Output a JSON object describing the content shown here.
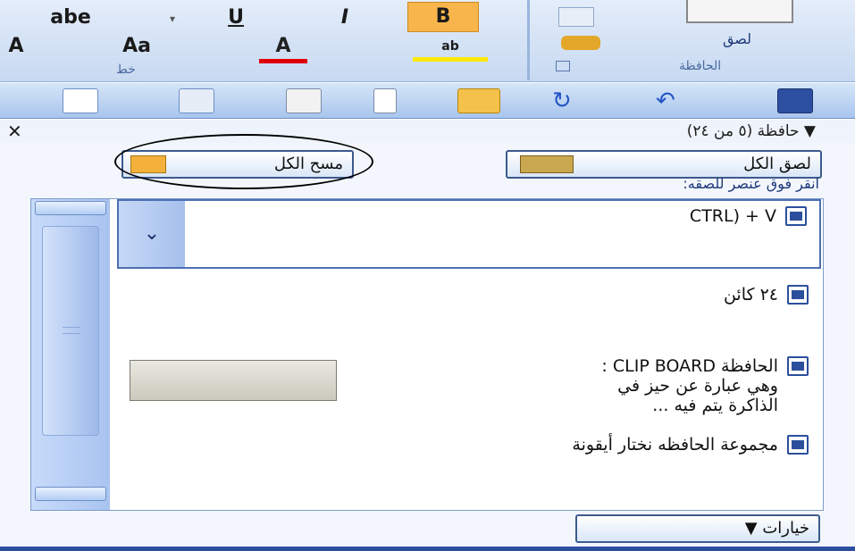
{
  "ribbon": {
    "font_group_label": "خط",
    "clipboard_group_label": "الحافظة",
    "paste_label": "لصق",
    "strike_label": "abe",
    "underline_label": "U",
    "italic_label": "I",
    "bold_label": "B",
    "grow_font_label": "A",
    "change_case_label": "Aa",
    "font_color_label": "A",
    "highlight_label": "ab"
  },
  "pane": {
    "title": "▼ حافظة (٥ من ٢٤)",
    "close": "✕",
    "paste_all_label": "لصق الكل",
    "clear_all_label": "مسح الكل",
    "hint": "انقر فوق عنصر للصقه:",
    "options_label": "خيارات ▼"
  },
  "items": [
    {
      "text": "CTRL) + V"
    },
    {
      "text": "٢٤ كائن"
    },
    {
      "text": "الحافظة CLIP BOARD : وهي عبارة عن حيز في الذاكرة يتم فيه ..."
    },
    {
      "text": "مجموعة الحافظه نختار أيقونة"
    }
  ],
  "colors": {
    "accent": "#3c5a8c",
    "ribbon_blue": "#c7d9f1",
    "font_color_bar": "#e00000",
    "highlight_bar": "#ffe800"
  }
}
